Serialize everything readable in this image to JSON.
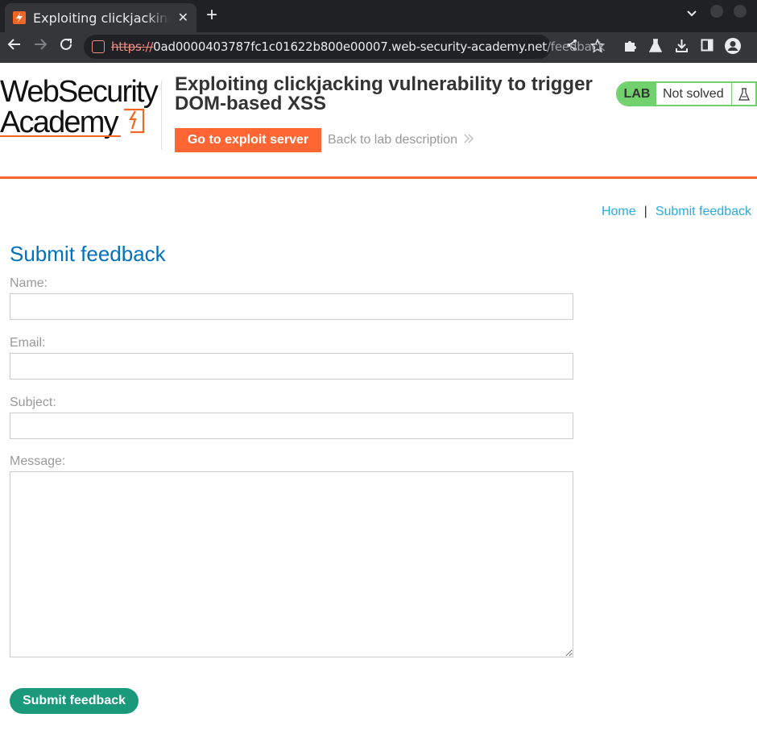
{
  "browser": {
    "tab_title": "Exploiting clickjacking vulnerability to trigger DOM-based XSS",
    "tab_close": "✕",
    "new_tab": "+",
    "url_scheme": "https://",
    "url_host": "0ad0000403787fc1c01622b800e00007.web-security-academy.net",
    "url_path": "/feedback"
  },
  "header": {
    "logo_line1": "WebSecurity",
    "logo_line2": "Academy",
    "lab_title": "Exploiting clickjacking vulnerability to trigger DOM-based XSS",
    "exploit_button": "Go to exploit server",
    "back_link": "Back to lab description",
    "badge_tag": "LAB",
    "badge_status": "Not solved"
  },
  "nav": {
    "home": "Home",
    "separator": "|",
    "submit_feedback": "Submit feedback"
  },
  "form": {
    "heading": "Submit feedback",
    "name_label": "Name:",
    "email_label": "Email:",
    "subject_label": "Subject:",
    "message_label": "Message:",
    "name_value": "",
    "email_value": "",
    "subject_value": "",
    "message_value": "",
    "submit_label": "Submit feedback"
  },
  "colors": {
    "accent_orange": "#ff6633",
    "lab_green": "#70d16d",
    "heading_blue": "#0071bc",
    "link_blue": "#29abe0",
    "submit_green": "#1a9a7a"
  }
}
